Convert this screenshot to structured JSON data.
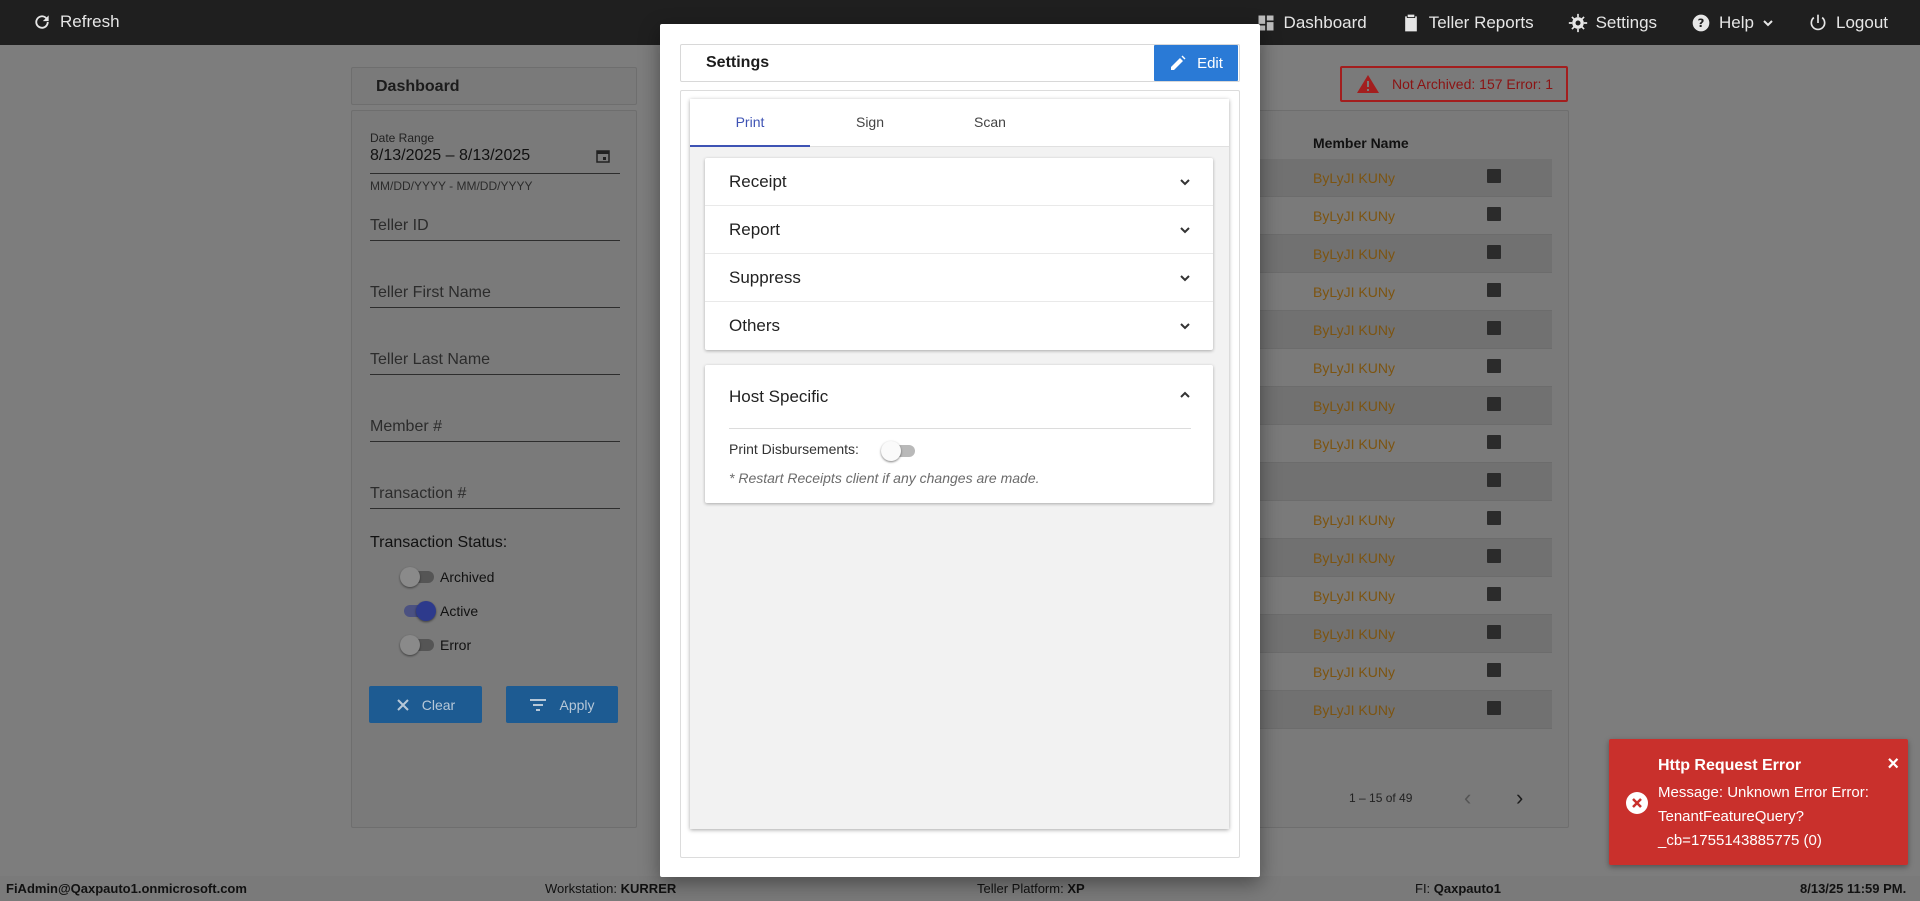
{
  "topbar": {
    "refresh": "Refresh",
    "dashboard": "Dashboard",
    "teller_reports": "Teller Reports",
    "settings": "Settings",
    "help": "Help",
    "logout": "Logout"
  },
  "dashboard": {
    "title": "Dashboard",
    "date_range_label": "Date Range",
    "date_range_value": "8/13/2025 – 8/13/2025",
    "date_hint": "MM/DD/YYYY - MM/DD/YYYY",
    "teller_id": "Teller ID",
    "teller_first": "Teller First Name",
    "teller_last": "Teller Last Name",
    "member": "Member #",
    "transaction": "Transaction #",
    "status_label": "Transaction Status:",
    "archived": "Archived",
    "active": "Active",
    "error": "Error",
    "clear": "Clear",
    "apply": "Apply"
  },
  "alert": {
    "text": "Not Archived: 157  Error: 1"
  },
  "table": {
    "header": "Member Name",
    "rows": [
      "ByLyJI KUNy",
      "ByLyJI KUNy",
      "ByLyJI KUNy",
      "ByLyJI KUNy",
      "ByLyJI KUNy",
      "ByLyJI KUNy",
      "ByLyJI KUNy",
      "ByLyJI KUNy",
      "",
      "ByLyJI KUNy",
      "ByLyJI KUNy",
      "ByLyJI KUNy",
      "ByLyJI KUNy",
      "ByLyJI KUNy",
      "ByLyJI KUNy"
    ],
    "pager": "1 – 15 of 49"
  },
  "modal": {
    "title": "Settings",
    "edit": "Edit",
    "tabs": [
      "Print",
      "Sign",
      "Scan"
    ],
    "sections": [
      "Receipt",
      "Report",
      "Suppress",
      "Others"
    ],
    "host_specific": "Host Specific",
    "print_disbursements": "Print Disbursements:",
    "restart_note": "* Restart Receipts client if any changes are made."
  },
  "toast": {
    "title": "Http Request Error",
    "message": "Message: Unknown Error Error: TenantFeatureQuery?_cb=1755143885775 (0)",
    "close": "×"
  },
  "statusbar": {
    "user": "FiAdmin@Qaxpauto1.onmicrosoft.com",
    "workstation_label": "Workstation:",
    "workstation_value": "KURRER",
    "platform_label": "Teller Platform:",
    "platform_value": "XP",
    "fi_label": "FI:",
    "fi_value": "Qaxpauto1",
    "datetime": "8/13/25 11:59 PM."
  },
  "colors": {
    "accent": "#2a7ad6",
    "tab_active": "#3e53b4",
    "error": "#c9302c"
  }
}
